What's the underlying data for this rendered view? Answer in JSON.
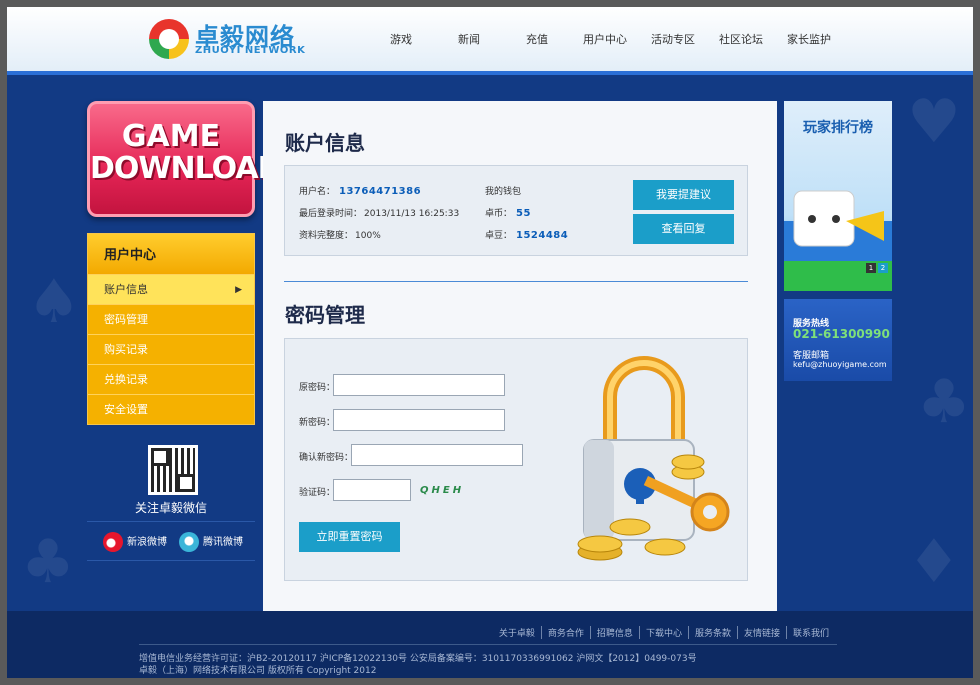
{
  "header": {
    "logo_cn": "卓毅网络",
    "logo_en": "ZHUOYI NETWORK",
    "nav": [
      "游戏",
      "新闻",
      "充值",
      "用户中心",
      "活动专区",
      "社区论坛",
      "家长监护"
    ]
  },
  "banner": {
    "line1": "GAME",
    "line2": "DOWNLOAD"
  },
  "sidebar": {
    "title": "用户中心",
    "items": [
      {
        "label": "账户信息",
        "active": true
      },
      {
        "label": "密码管理"
      },
      {
        "label": "购买记录"
      },
      {
        "label": "兑换记录"
      },
      {
        "label": "安全设置"
      }
    ],
    "arrow": "▶",
    "qr_caption": "关注卓毅微信",
    "sina_label": "新浪微博",
    "tencent_label": "腾讯微博"
  },
  "account": {
    "title": "账户信息",
    "username_label": "用户名：",
    "username": "13764471386",
    "last_login_label": "最后登录时间：",
    "last_login": "2013/11/13 16:25:33",
    "completeness_label": "资料完整度：",
    "completeness": "100%",
    "wallet_label": "我的钱包",
    "coin_label": "卓币：",
    "coin": "55",
    "bean_label": "卓豆：",
    "bean": "1524484",
    "suggest_btn": "我要提建议",
    "reply_btn": "查看回复"
  },
  "password": {
    "title": "密码管理",
    "old_label": "原密码：",
    "new_label": "新密码：",
    "confirm_label": "确认新密码：",
    "captcha_label": "验证码：",
    "captcha": "QHEH",
    "reset_btn": "立即重置密码"
  },
  "right": {
    "rank_title": "玩家排行榜",
    "slide_nums": [
      "1",
      "2"
    ],
    "hotline_label": "服务热线",
    "hotline": "021-61300990",
    "email_label": "客服邮箱",
    "email": "kefu@zhuoyigame.com"
  },
  "footer": {
    "links": [
      "关于卓毅",
      "商务合作",
      "招聘信息",
      "下载中心",
      "服务条款",
      "友情链接",
      "联系我们"
    ],
    "license": "增值电信业务经营许可证：沪B2-20120117 沪ICP备12022130号 公安局备案编号：3101170336991062 沪网文【2012】0499-073号",
    "copyright": "卓毅（上海）网络技术有限公司 版权所有 Copyright 2012"
  },
  "colors": {
    "accent": "#1b9ec9",
    "brand_blue": "#123a84",
    "menu_yellow": "#f5b100",
    "banner_red": "#e42455"
  }
}
